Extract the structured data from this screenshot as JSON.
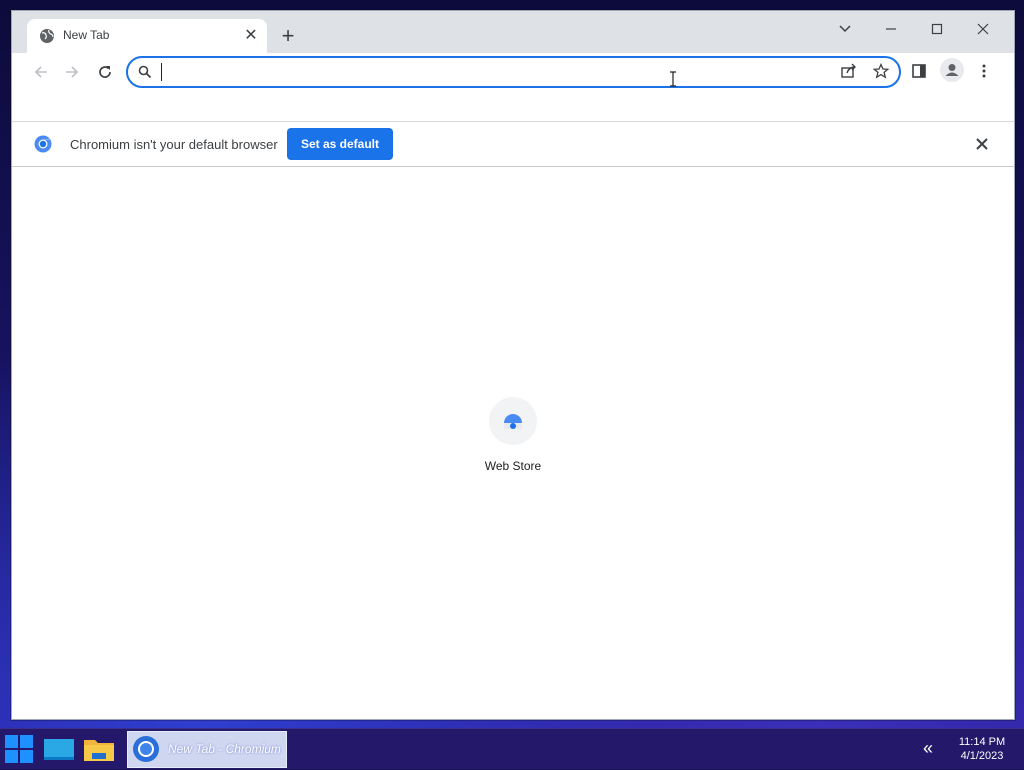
{
  "browser": {
    "tab": {
      "title": "New Tab",
      "close_glyph": "✕",
      "favicon": "globe-icon"
    },
    "new_tab_glyph": "+",
    "window_controls": [
      "chevron-down-icon",
      "minimize-icon",
      "maximize-icon",
      "close-icon"
    ],
    "omnibox": {
      "value": "",
      "placeholder": ""
    },
    "toolbar_icons": [
      "back-icon",
      "forward-icon",
      "reload-icon",
      "search-icon",
      "share-icon",
      "star-icon",
      "side-panel-icon",
      "profile-icon",
      "menu-icon"
    ]
  },
  "infobar": {
    "message": "Chromium isn't your default browser",
    "button_label": "Set as default",
    "icon": "chromium-icon"
  },
  "ntp": {
    "shortcuts": [
      {
        "label": "Web Store",
        "icon": "web-store-icon"
      }
    ]
  },
  "taskbar": {
    "task_label": "New Tab - Chromium",
    "tray_glyph": "«",
    "time": "11:14 PM",
    "date": "4/1/2023",
    "apps": [
      "start-icon",
      "desktop-icon",
      "file-explorer-icon",
      "chromium-icon"
    ]
  },
  "colors": {
    "accent": "#1a73e8",
    "tabstrip": "#dee1e6",
    "taskbar": "#24186a"
  }
}
